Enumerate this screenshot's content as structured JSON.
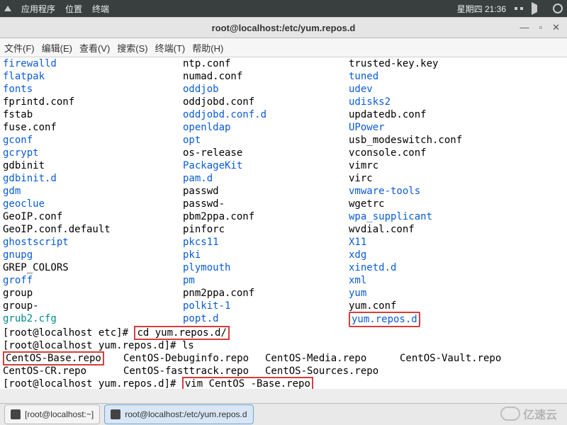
{
  "topbar": {
    "apps": "应用程序",
    "places": "位置",
    "terminal_label": "终端",
    "datetime": "星期四 21:36"
  },
  "window": {
    "title": "root@localhost:/etc/yum.repos.d"
  },
  "menu": {
    "file": "文件(F)",
    "edit": "编辑(E)",
    "view": "查看(V)",
    "search": "搜索(S)",
    "terminal": "终端(T)",
    "help": "帮助(H)"
  },
  "listing": [
    {
      "c0": {
        "text": "firewalld",
        "cls": "link"
      },
      "c1": {
        "text": "ntp.conf",
        "cls": "plain"
      },
      "c2": {
        "text": "trusted-key.key",
        "cls": "plain"
      }
    },
    {
      "c0": {
        "text": "flatpak",
        "cls": "link"
      },
      "c1": {
        "text": "numad.conf",
        "cls": "plain"
      },
      "c2": {
        "text": "tuned",
        "cls": "link"
      }
    },
    {
      "c0": {
        "text": "fonts",
        "cls": "link"
      },
      "c1": {
        "text": "oddjob",
        "cls": "link"
      },
      "c2": {
        "text": "udev",
        "cls": "link"
      }
    },
    {
      "c0": {
        "text": "fprintd.conf",
        "cls": "plain"
      },
      "c1": {
        "text": "oddjobd.conf",
        "cls": "plain"
      },
      "c2": {
        "text": "udisks2",
        "cls": "link"
      }
    },
    {
      "c0": {
        "text": "fstab",
        "cls": "plain"
      },
      "c1": {
        "text": "oddjobd.conf.d",
        "cls": "link"
      },
      "c2": {
        "text": "updatedb.conf",
        "cls": "plain"
      }
    },
    {
      "c0": {
        "text": "fuse.conf",
        "cls": "plain"
      },
      "c1": {
        "text": "openldap",
        "cls": "link"
      },
      "c2": {
        "text": "UPower",
        "cls": "link"
      }
    },
    {
      "c0": {
        "text": "gconf",
        "cls": "link"
      },
      "c1": {
        "text": "opt",
        "cls": "link"
      },
      "c2": {
        "text": "usb_modeswitch.conf",
        "cls": "plain"
      }
    },
    {
      "c0": {
        "text": "gcrypt",
        "cls": "link"
      },
      "c1": {
        "text": "os-release",
        "cls": "plain"
      },
      "c2": {
        "text": "vconsole.conf",
        "cls": "plain"
      }
    },
    {
      "c0": {
        "text": "gdbinit",
        "cls": "plain"
      },
      "c1": {
        "text": "PackageKit",
        "cls": "link"
      },
      "c2": {
        "text": "vimrc",
        "cls": "plain"
      }
    },
    {
      "c0": {
        "text": "gdbinit.d",
        "cls": "link"
      },
      "c1": {
        "text": "pam.d",
        "cls": "link"
      },
      "c2": {
        "text": "virc",
        "cls": "plain"
      }
    },
    {
      "c0": {
        "text": "gdm",
        "cls": "link"
      },
      "c1": {
        "text": "passwd",
        "cls": "plain"
      },
      "c2": {
        "text": "vmware-tools",
        "cls": "link"
      }
    },
    {
      "c0": {
        "text": "geoclue",
        "cls": "link"
      },
      "c1": {
        "text": "passwd-",
        "cls": "plain"
      },
      "c2": {
        "text": "wgetrc",
        "cls": "plain"
      }
    },
    {
      "c0": {
        "text": "GeoIP.conf",
        "cls": "plain"
      },
      "c1": {
        "text": "pbm2ppa.conf",
        "cls": "plain"
      },
      "c2": {
        "text": "wpa_supplicant",
        "cls": "link"
      }
    },
    {
      "c0": {
        "text": "GeoIP.conf.default",
        "cls": "plain"
      },
      "c1": {
        "text": "pinforc",
        "cls": "plain"
      },
      "c2": {
        "text": "wvdial.conf",
        "cls": "plain"
      }
    },
    {
      "c0": {
        "text": "ghostscript",
        "cls": "link"
      },
      "c1": {
        "text": "pkcs11",
        "cls": "link"
      },
      "c2": {
        "text": "X11",
        "cls": "link"
      }
    },
    {
      "c0": {
        "text": "gnupg",
        "cls": "link"
      },
      "c1": {
        "text": "pki",
        "cls": "link"
      },
      "c2": {
        "text": "xdg",
        "cls": "link"
      }
    },
    {
      "c0": {
        "text": "GREP_COLORS",
        "cls": "plain"
      },
      "c1": {
        "text": "plymouth",
        "cls": "link"
      },
      "c2": {
        "text": "xinetd.d",
        "cls": "link"
      }
    },
    {
      "c0": {
        "text": "groff",
        "cls": "link"
      },
      "c1": {
        "text": "pm",
        "cls": "link"
      },
      "c2": {
        "text": "xml",
        "cls": "link"
      }
    },
    {
      "c0": {
        "text": "group",
        "cls": "plain"
      },
      "c1": {
        "text": "pnm2ppa.conf",
        "cls": "plain"
      },
      "c2": {
        "text": "yum",
        "cls": "link"
      }
    },
    {
      "c0": {
        "text": "group-",
        "cls": "plain"
      },
      "c1": {
        "text": "polkit-1",
        "cls": "link"
      },
      "c2": {
        "text": "yum.conf",
        "cls": "plain"
      }
    },
    {
      "c0": {
        "text": "grub2.cfg",
        "cls": "teal"
      },
      "c1": {
        "text": "popt.d",
        "cls": "link"
      },
      "c2": {
        "text": "yum.repos.d",
        "cls": "link",
        "boxed": true
      }
    }
  ],
  "prompts": {
    "p1_prefix": "[root@localhost etc]# ",
    "p1_cmd": "cd yum.repos.d/",
    "p2": "[root@localhost yum.repos.d]# ls",
    "p3_prefix": "[root@localhost yum.repos.d]# ",
    "p3_cmd": "vim CentOS -Base.repo"
  },
  "repos": {
    "r1c0": "CentOS-Base.repo",
    "r1c1": "CentOS-Debuginfo.repo",
    "r1c2": "CentOS-Media.repo",
    "r1c3": "CentOS-Vault.repo",
    "r2c0": "CentOS-CR.repo",
    "r2c1": "CentOS-fasttrack.repo",
    "r2c2": "CentOS-Sources.repo"
  },
  "taskbar": {
    "t1": "[root@localhost:~]",
    "t2": "root@localhost:/etc/yum.repos.d"
  },
  "watermark": "亿速云"
}
